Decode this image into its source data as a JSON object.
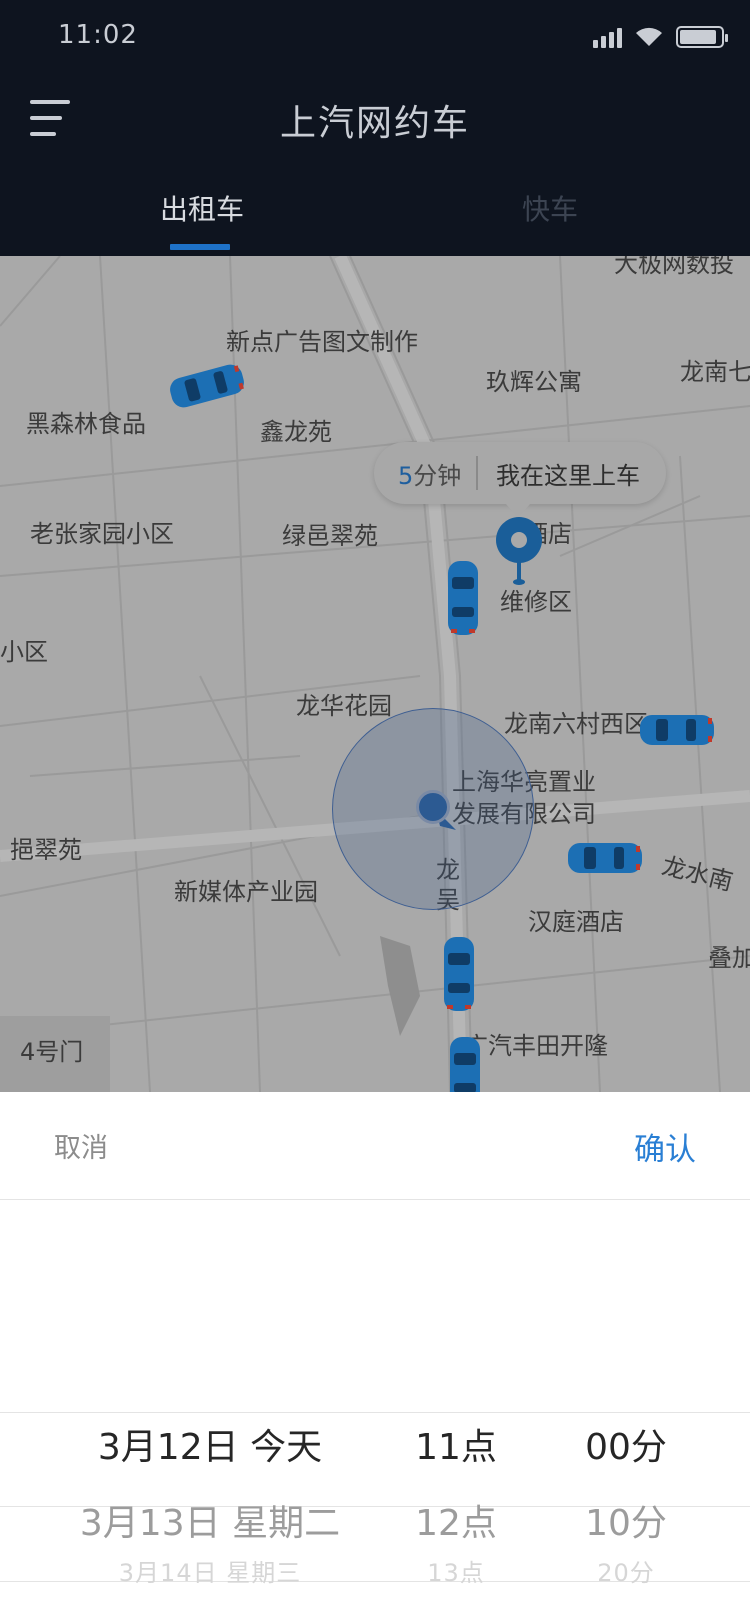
{
  "status_bar": {
    "time": "11:02",
    "battery_level": 0.9
  },
  "header": {
    "title": "上汽网约车"
  },
  "tabs": [
    {
      "label": "出租车",
      "active": true
    },
    {
      "label": "快车",
      "active": false
    }
  ],
  "map": {
    "labels": [
      "新点广告图文制作",
      "玖辉公寓",
      "龙南七",
      "黑森林食品",
      "鑫龙苑",
      "老张家园小区",
      "绿邑翠苑",
      "泰酒店",
      "维修区",
      "小区",
      "龙华花园",
      "龙南六村西区",
      "上海华亮置业",
      "发展有限公司",
      "挹翠苑",
      "龙",
      "吴",
      "龙水南",
      "新媒体产业园",
      "汉庭酒店",
      "叠加",
      "4号门",
      "广汽丰田开隆",
      "大极网数投"
    ],
    "callout": {
      "eta_number": "5",
      "eta_unit": "分钟",
      "text": "我在这里上车"
    }
  },
  "picker": {
    "cancel_label": "取消",
    "confirm_label": "确认",
    "rows": [
      {
        "date": "3月12日 今天",
        "hour": "11点",
        "minute": "00分"
      },
      {
        "date": "3月13日 星期二",
        "hour": "12点",
        "minute": "10分"
      },
      {
        "date": "3月14日 星期三",
        "hour": "13点",
        "minute": "20分"
      }
    ]
  },
  "colors": {
    "accent": "#2a7fd4",
    "header_bg": "#0e141f",
    "tab_indicator": "#1e72c8",
    "car_blue": "#1c6fb4"
  }
}
